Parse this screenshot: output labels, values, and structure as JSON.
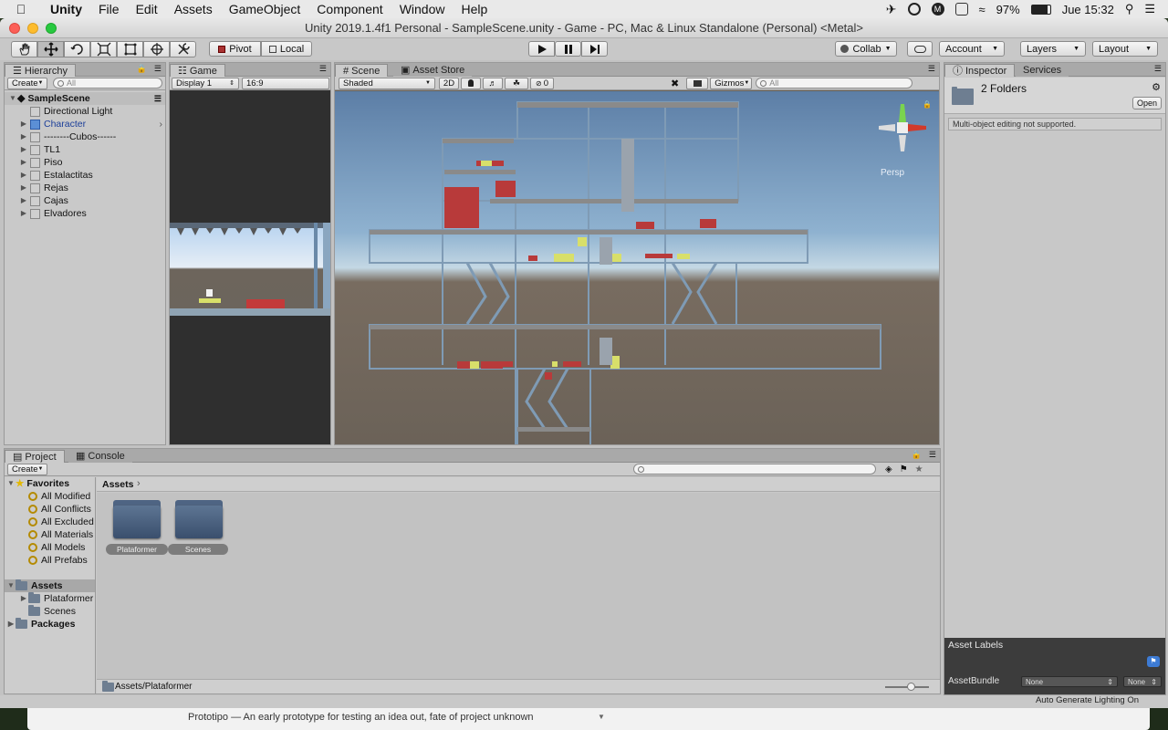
{
  "menubar": {
    "app": "Unity",
    "items": [
      "File",
      "Edit",
      "Assets",
      "GameObject",
      "Component",
      "Window",
      "Help"
    ],
    "battery": "97%",
    "clock": "Jue 15:32"
  },
  "window": {
    "title": "Unity 2019.1.4f1 Personal - SampleScene.unity - Game - PC, Mac & Linux Standalone (Personal) <Metal>"
  },
  "toolbar": {
    "pivot": "Pivot",
    "local": "Local",
    "collab": "Collab",
    "account": "Account",
    "layers": "Layers",
    "layout": "Layout"
  },
  "hierarchy": {
    "tab": "Hierarchy",
    "create": "Create",
    "search": "All",
    "scene": "SampleScene",
    "items": [
      "Directional Light",
      "Character",
      "--------Cubos------",
      "TL1",
      "Piso",
      "Estalactitas",
      "Rejas",
      "Cajas",
      "Elvadores"
    ]
  },
  "game": {
    "tab": "Game",
    "display": "Display 1",
    "aspect": "16:9"
  },
  "scene": {
    "tab": "Scene",
    "tab2": "Asset Store",
    "shading": "Shaded",
    "mode2d": "2D",
    "fxcount": "0",
    "gizmos": "Gizmos",
    "search": "All",
    "persp": "Persp"
  },
  "inspector": {
    "tab": "Inspector",
    "tab2": "Services",
    "title": "2 Folders",
    "open": "Open",
    "note": "Multi-object editing not supported.",
    "labels": "Asset Labels",
    "bundle": "AssetBundle",
    "none1": "None",
    "none2": "None"
  },
  "project": {
    "tab": "Project",
    "tab2": "Console",
    "create": "Create",
    "favorites": "Favorites",
    "fav_items": [
      "All Modified",
      "All Conflicts",
      "All Excluded",
      "All Materials",
      "All Models",
      "All Prefabs"
    ],
    "assets": "Assets",
    "tree": [
      "Plataformer",
      "Scenes"
    ],
    "packages": "Packages",
    "breadcrumb": "Assets",
    "folders": [
      "Plataformer",
      "Scenes"
    ],
    "footer_path": "Assets/Plataformer"
  },
  "status": {
    "lighting": "Auto Generate Lighting On"
  },
  "background_text": "Prototipo — An early prototype for testing an idea out, fate of project unknown"
}
